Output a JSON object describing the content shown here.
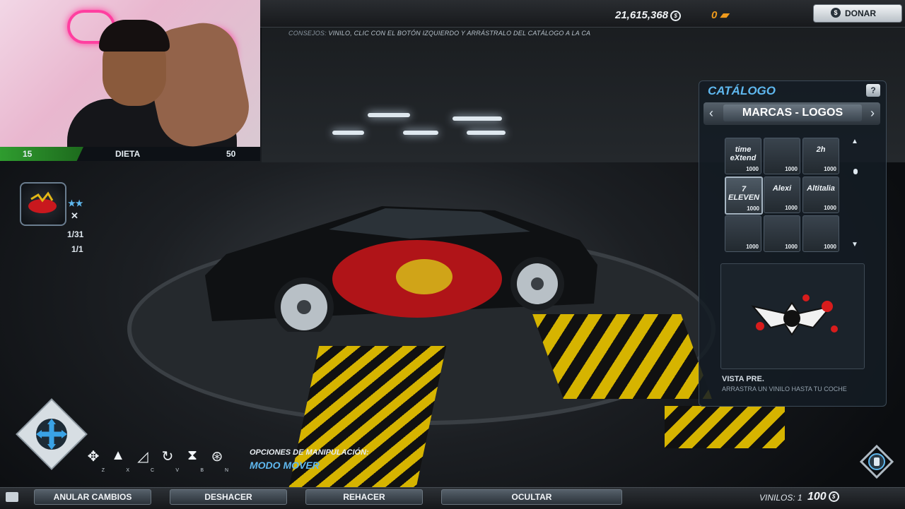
{
  "stream": {
    "bar_left": "15",
    "bar_label": "DIETA",
    "bar_right": "50"
  },
  "header": {
    "tips_label": "CONSEJOS:",
    "tips_text": "VINILO, CLIC CON EL BOTÓN IZQUIERDO Y ARRÁSTRALO DEL CATÁLOGO A LA CA",
    "money": "21,615,368",
    "boost": "0",
    "donate_label": "DONAR"
  },
  "vinyl_slot": {
    "count_a": "1/31",
    "count_b": "1/1"
  },
  "catalog": {
    "title": "CATÁLOGO",
    "help": "?",
    "category": "MARCAS - LOGOS",
    "tiles": [
      {
        "logo": "time eXtend",
        "price": "1000"
      },
      {
        "logo": "",
        "price": "1000"
      },
      {
        "logo": "2h",
        "price": "1000"
      },
      {
        "logo": "7 ELEVEN",
        "price": "1000"
      },
      {
        "logo": "Alexi",
        "price": "1000"
      },
      {
        "logo": "Altitalia",
        "price": "1000"
      },
      {
        "logo": "",
        "price": "1000"
      },
      {
        "logo": "",
        "price": "1000"
      },
      {
        "logo": "",
        "price": "1000"
      }
    ],
    "preview_title": "VISTA PRE.",
    "preview_hint": "ARRASTRA UN VINILO HASTA TU COCHE"
  },
  "tools": {
    "keys": [
      "Z",
      "X",
      "C",
      "V",
      "B",
      "N"
    ]
  },
  "manipulation": {
    "label": "OPCIONES DE MANIPULACIÓN:",
    "mode": "MODO MOVER"
  },
  "bottom": {
    "cancel": "ANULAR CAMBIOS",
    "undo": "DESHACER",
    "redo": "REHACER",
    "hide": "OCULTAR",
    "vinyls": "VINILOS: 1",
    "cost": "100"
  },
  "colors": {
    "accent": "#5fb8ef",
    "boost": "#f09a1c",
    "diet_green": "#2f9c2f"
  }
}
